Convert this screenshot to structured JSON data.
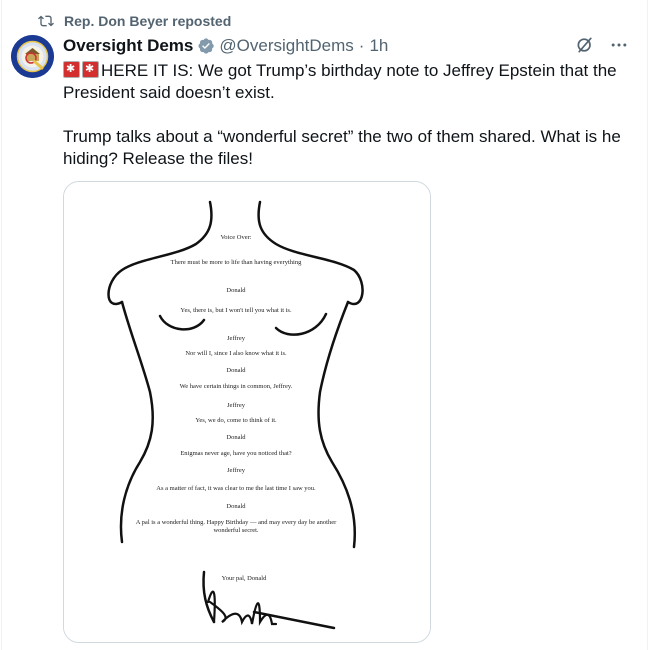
{
  "repost": {
    "label": "Rep. Don Beyer reposted",
    "icon": "repost-icon"
  },
  "author": {
    "name": "Oversight Dems",
    "handle": "@OversightDems",
    "separator": "·",
    "time": "1h"
  },
  "tweet": {
    "line1_text": "HERE IT IS: We got Trump’s birthday note to Jeffrey Epstein that the President said doesn’t exist.",
    "line2_text": "Trump talks about a “wonderful secret” the two of them shared. What is he hiding? Release the files!"
  },
  "colors": {
    "accent": "#1d9bf0",
    "muted": "#536471",
    "text": "#0f1419",
    "alarm": "#d32f2f"
  },
  "letter": {
    "lines": [
      "Voice Over:",
      "There must be more to life than having everything",
      "Donald",
      "Yes, there is, but I won't tell you what it is.",
      "Jeffrey",
      "Nor will I, since I also know what it is.",
      "Donald",
      "We have certain things in common, Jeffrey.",
      "Jeffrey",
      "Yes, we do, come to think of it.",
      "Donald",
      "Enigmas never age, have you noticed that?",
      "Jeffrey",
      "As a matter of fact, it was clear to me the last time I saw you.",
      "Donald",
      "A pal is a wonderful thing. Happy Birthday — and may every day be another",
      "wonderful secret.",
      "Your pal, Donald"
    ]
  }
}
